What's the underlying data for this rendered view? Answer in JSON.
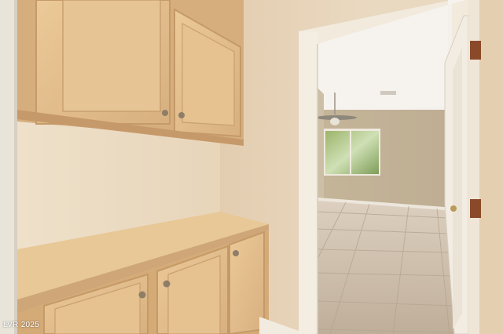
{
  "photo": {
    "subject": "",
    "watermark": "LVR 2025"
  },
  "colors": {
    "wall": "#ecdcc4",
    "cabinet_wood": "#e2be8e",
    "countertop": "#e8c897",
    "door_trim": "#f4ece0",
    "hinge": "#8a4a2a",
    "tile_floor": "#cfc2b2",
    "far_wall": "#c9b99e",
    "ceiling": "#f4f1ec"
  },
  "icons": [
    "ceiling-fan-icon",
    "window-icon",
    "cabinet-knob-icon",
    "door-hinge-icon"
  ]
}
